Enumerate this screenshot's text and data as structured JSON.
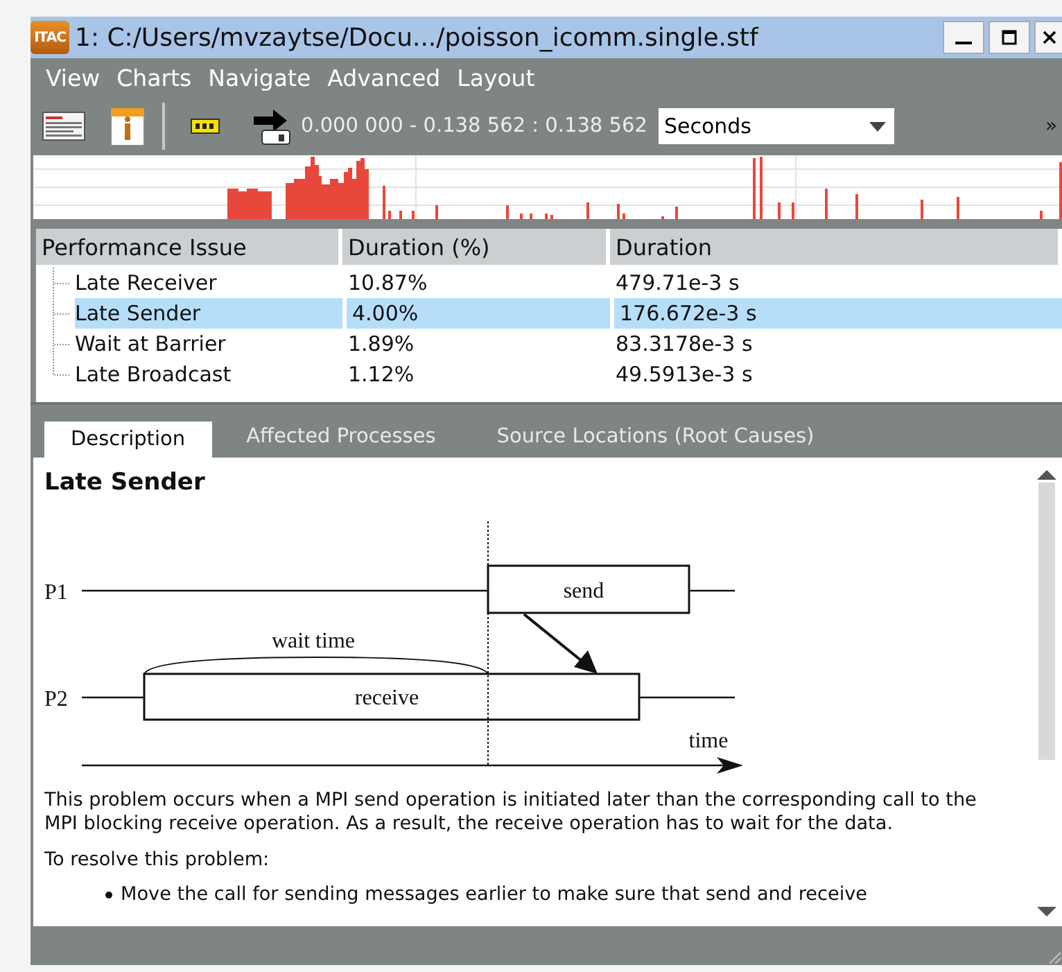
{
  "window": {
    "icon_text": "ITAC",
    "title": "1: C:/Users/mvzaytse/Docu.../poisson_icomm.single.stf"
  },
  "menu": [
    "View",
    "Charts",
    "Navigate",
    "Advanced",
    "Layout"
  ],
  "toolbar": {
    "time_range": "0.000 000 - 0.138 562 : 0.138 562",
    "unit": "Seconds",
    "overflow": "»"
  },
  "table": {
    "columns": [
      "Performance Issue",
      "Duration (%)",
      "Duration"
    ],
    "rows": [
      {
        "issue": "Late Receiver",
        "percent": "10.87%",
        "duration": "479.71e-3 s",
        "selected": false
      },
      {
        "issue": "Late Sender",
        "percent": "4.00%",
        "duration": "176.672e-3 s",
        "selected": true
      },
      {
        "issue": "Wait at Barrier",
        "percent": "1.89%",
        "duration": "83.3178e-3 s",
        "selected": false
      },
      {
        "issue": "Late Broadcast",
        "percent": "1.12%",
        "duration": "49.5913e-3 s",
        "selected": false
      }
    ]
  },
  "tabs": [
    {
      "label": "Description",
      "selected": true
    },
    {
      "label": "Affected Processes",
      "selected": false
    },
    {
      "label": "Source Locations (Root Causes)",
      "selected": false
    }
  ],
  "description": {
    "title": "Late Sender",
    "diagram": {
      "p1": "P1",
      "p2": "P2",
      "send": "send",
      "receive": "receive",
      "wait": "wait time",
      "time": "time"
    },
    "paragraphs": [
      "This problem occurs when a MPI send operation is initiated later than the corresponding call to the MPI blocking receive operation. As a result, the receive operation has to wait for the data.",
      "To resolve this problem:"
    ],
    "bullets": [
      "Move the call for sending messages earlier to make sure that send and receive"
    ]
  }
}
